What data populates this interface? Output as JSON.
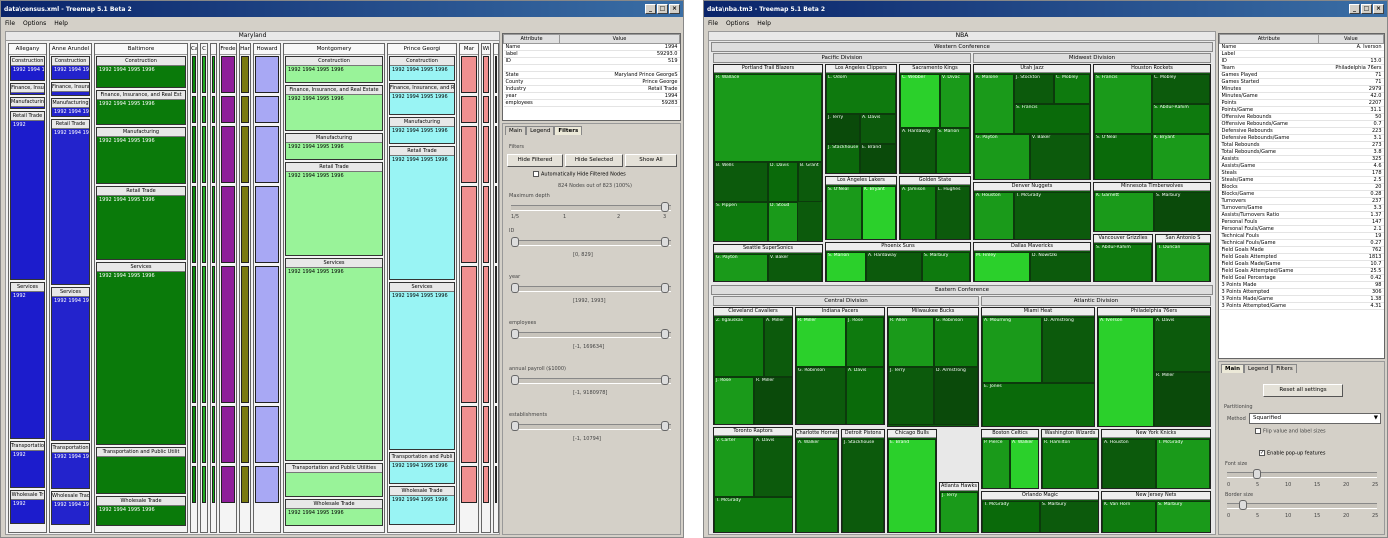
{
  "win1": {
    "title": "data\\census.xml - Treemap 5.1 Beta 2",
    "menu": [
      "File",
      "Options",
      "Help"
    ],
    "root_label": "Maryland",
    "counties": [
      {
        "name": "Allegany",
        "industries": [
          {
            "name": "Construction",
            "yrs": "1992 1994 1995"
          },
          {
            "name": "Finance, Insu",
            "yrs": "1992"
          },
          {
            "name": "Manufacturin",
            "yrs": "1992"
          },
          {
            "name": "Retail Trade",
            "yrs": "1992"
          },
          {
            "name": "Services",
            "yrs": "1992"
          },
          {
            "name": "Transportatio",
            "yrs": "1992"
          },
          {
            "name": "Wholesale Tr",
            "yrs": "1992"
          }
        ]
      },
      {
        "name": "Anne Arundel",
        "industries": [
          {
            "name": "Construction",
            "yrs": "1992 1994 1995"
          },
          {
            "name": "Finance, Insura",
            "yrs": ""
          },
          {
            "name": "Manufacturing",
            "yrs": "1992 1994 1995"
          },
          {
            "name": "Retail Trade",
            "yrs": "1992 1994 1995"
          },
          {
            "name": "Services",
            "yrs": "1992 1994 1995"
          },
          {
            "name": "Transportation",
            "yrs": "1992 1994 1995"
          },
          {
            "name": "Wholesale Trad",
            "yrs": "1992 1994 1995"
          }
        ]
      },
      {
        "name": "Baltimore",
        "industries": [
          {
            "name": "Construction",
            "yrs": "1992 1994 1995 1996"
          },
          {
            "name": "Finance, Insurance, and Real Est",
            "yrs": "1992 1994 1995 1996"
          },
          {
            "name": "Manufacturing",
            "yrs": "1992 1994 1995 1996"
          },
          {
            "name": "Retail Trade",
            "yrs": "1992 1994 1995 1996"
          },
          {
            "name": "Services",
            "yrs": "1992 1994 1995 1996"
          },
          {
            "name": "Transportation and Public Utilit",
            "yrs": ""
          },
          {
            "name": "Wholesale Trade",
            "yrs": "1992 1994 1995 1996"
          }
        ]
      },
      {
        "name": "Montgomery",
        "industries": [
          {
            "name": "Construction",
            "yrs": "1992 1994 1995 1996"
          },
          {
            "name": "Finance, Insurance, and Real Estate",
            "yrs": "1992 1994 1995 1996"
          },
          {
            "name": "Manufacturing",
            "yrs": "1992 1994 1995 1996"
          },
          {
            "name": "Retail Trade",
            "yrs": "1992 1994 1995 1996"
          },
          {
            "name": "Services",
            "yrs": "1992 1994 1995 1996"
          },
          {
            "name": "Transportation and Public Utilities",
            "yrs": ""
          },
          {
            "name": "Wholesale Trade",
            "yrs": "1992 1994 1995 1996"
          }
        ]
      },
      {
        "name": "Prince Georgi",
        "industries": [
          {
            "name": "Construction",
            "yrs": "1992 1994 1995 1996"
          },
          {
            "name": "Finance, Insurance, and R",
            "yrs": "1992 1994 1995 1996"
          },
          {
            "name": "Manufacturing",
            "yrs": "1992 1994 1995 1996"
          },
          {
            "name": "Retail Trade",
            "yrs": "1992 1994 1995 1996"
          },
          {
            "name": "Services",
            "yrs": "1992 1994 1995 1996"
          },
          {
            "name": "Transportation and Publi",
            "yrs": "1992 1994 1995 1996"
          },
          {
            "name": "Wholesale Trade",
            "yrs": "1992 1994 1995 1996"
          }
        ]
      }
    ],
    "small_headers": [
      "Cal",
      "C",
      "Frede",
      "Har",
      "Howard",
      "Mar",
      "Wi"
    ],
    "attr_headers": [
      "Attribute",
      "Value"
    ],
    "attrs": [
      {
        "k": "Name",
        "v": "1994"
      },
      {
        "k": "label",
        "v": "59293.0"
      },
      {
        "k": "ID",
        "v": "519"
      },
      {
        "k": "",
        "v": ""
      },
      {
        "k": "State",
        "v": "Maryland Prince GeorgeS"
      },
      {
        "k": "County",
        "v": "Prince George"
      },
      {
        "k": "Industry",
        "v": "Retail Trade"
      },
      {
        "k": "year",
        "v": "1994"
      },
      {
        "k": "employees",
        "v": "59283"
      }
    ],
    "tabs": [
      "Main",
      "Legend",
      "Filters"
    ],
    "filters_label": "Filters",
    "buttons": {
      "hide_filtered": "Hide Filtered",
      "hide_selected": "Hide Selected",
      "show_all": "Show All"
    },
    "auto_hide": "Automatically Hide Filtered Nodes",
    "counts": "824 Nodes out of 823 (100%)",
    "depth_label": "Maximum depth",
    "depth_ticks": [
      "1/5",
      "1",
      "2",
      "3"
    ],
    "sliders": [
      {
        "name": "ID",
        "range": "[0, 829]"
      },
      {
        "name": "year",
        "range": "[1992, 1993]"
      },
      {
        "name": "employees",
        "range": "[-1, 169634]"
      },
      {
        "name": "annual payroll ($1000)",
        "range": "[-1, 9180978]"
      },
      {
        "name": "establishments",
        "range": "[-1, 10794]"
      }
    ]
  },
  "win2": {
    "title": "data\\nba.tm3 - Treemap 5.1 Beta 2",
    "menu": [
      "File",
      "Options",
      "Help"
    ],
    "root_label": "NBA",
    "west": "Western Conference",
    "east": "Eastern Conference",
    "divisions": {
      "pacific": "Pacific Division",
      "midwest": "Midwest Division",
      "central": "Central Division",
      "atlantic": "Atlantic Division"
    },
    "teams": {
      "portland": "Portland Trail Blazers",
      "clippers": "Los Angeles Clippers",
      "sacramento": "Sacramento Kings",
      "utah": "Utah Jazz",
      "houston": "Houston Rockets",
      "lakers": "Los Angeles Lakers",
      "gsw": "Golden State",
      "seattle": "Seattle SuperSonics",
      "phoenix": "Phoenix Suns",
      "denver": "Denver Nuggets",
      "minnesota": "Minnesota Timberwolves",
      "dallas": "Dallas Mavericks",
      "vancouver": "Vancouver Grizzlies",
      "sanantonio": "San Antonio S",
      "cleveland": "Cleveland Cavaliers",
      "indiana": "Indiana Pacers",
      "milwaukee": "Milwaukee Bucks",
      "miami": "Miami Heat",
      "philadelphia": "Philadelphia 76ers",
      "toronto": "Toronto Raptors",
      "charlotte": "Charlotte Hornets",
      "detroit": "Detroit Pistons",
      "chicago": "Chicago Bulls",
      "atlanta": "Atlanta Hawks",
      "boston": "Boston Celtics",
      "washington": "Washington Wizards",
      "newyork": "New York Knicks",
      "orlando": "Orlando Magic",
      "newjersey": "New Jersey Nets"
    },
    "players": {
      "p1": "R. Wallace",
      "p2": "S. Pippen",
      "p3": "B. Wells",
      "p4": "D. Davis",
      "p5": "B. Grant",
      "p6": "D. Stoud",
      "p7": "L. Odom",
      "p8": "C. Webber",
      "p9": "V. Divac",
      "p10": "K. Malone",
      "p11": "J. Stockton",
      "p12": "S. Francis",
      "p13": "C. Mobley",
      "p14": "G. Payton",
      "p15": "V. Baker",
      "p16": "A. Hardaway",
      "p17": "S. Marion",
      "p18": "S. O'Neal",
      "p19": "K. Bryant",
      "p20": "A. Jamison",
      "p21": "L. Hughes",
      "p22": "M. Finley",
      "p23": "D. Nowitzki",
      "p24": "S. Abdur-Rahim",
      "p25": "T. Duncan",
      "p26": "K. Garnett",
      "p27": "Z. Ilgauskas",
      "p28": "A. Miller",
      "p29": "J. Rose",
      "p30": "R. Miller",
      "p31": "G. Robinson",
      "p32": "R. Allen",
      "p33": "A. Mourning",
      "p34": "A. Iverson",
      "p35": "V. Carter",
      "p36": "A. Davis",
      "p37": "E. Jones",
      "p38": "J. Stackhouse",
      "p39": "E. Brand",
      "p40": "J. Terry",
      "p41": "P. Pierce",
      "p42": "A. Walker",
      "p43": "R. Hamilton",
      "p44": "A. Houston",
      "p45": "T. McGrady",
      "p46": "K. Van Horn",
      "p47": "S. Marbury",
      "p48": "D. Armstrong"
    },
    "attr_headers": [
      "Attribute",
      "Value"
    ],
    "attrs": [
      {
        "k": "Name",
        "v": "A. Iverson"
      },
      {
        "k": "Label",
        "v": ""
      },
      {
        "k": "ID",
        "v": "13.0"
      },
      {
        "k": "Team",
        "v": "Philadelphia 76ers"
      },
      {
        "k": "Games Played",
        "v": "71"
      },
      {
        "k": "Games Started",
        "v": "71"
      },
      {
        "k": "Minutes",
        "v": "2979"
      },
      {
        "k": "Minutes/Game",
        "v": "42.0"
      },
      {
        "k": "Points",
        "v": "2207"
      },
      {
        "k": "Points/Game",
        "v": "31.1"
      },
      {
        "k": "Offensive Rebounds",
        "v": "50"
      },
      {
        "k": "Offensive Rebounds/Game",
        "v": "0.7"
      },
      {
        "k": "Defensive Rebounds",
        "v": "223"
      },
      {
        "k": "Defensive Rebounds/Game",
        "v": "3.1"
      },
      {
        "k": "Total Rebounds",
        "v": "273"
      },
      {
        "k": "Total Rebounds/Game",
        "v": "3.8"
      },
      {
        "k": "Assists",
        "v": "325"
      },
      {
        "k": "Assists/Game",
        "v": "4.6"
      },
      {
        "k": "Steals",
        "v": "178"
      },
      {
        "k": "Steals/Game",
        "v": "2.5"
      },
      {
        "k": "Blocks",
        "v": "20"
      },
      {
        "k": "Blocks/Game",
        "v": "0.28"
      },
      {
        "k": "Turnovers",
        "v": "237"
      },
      {
        "k": "Turnovers/Game",
        "v": "3.3"
      },
      {
        "k": "Assists/Turnovers Ratio",
        "v": "1.37"
      },
      {
        "k": "Personal Fouls",
        "v": "147"
      },
      {
        "k": "Personal Fouls/Game",
        "v": "2.1"
      },
      {
        "k": "Technical Fouls",
        "v": "19"
      },
      {
        "k": "Technical Fouls/Game",
        "v": "0.27"
      },
      {
        "k": "Field Goals Made",
        "v": "762"
      },
      {
        "k": "Field Goals Attempted",
        "v": "1813"
      },
      {
        "k": "Field Goals Made/Game",
        "v": "10.7"
      },
      {
        "k": "Field Goals Attempted/Game",
        "v": "25.5"
      },
      {
        "k": "Field Goal Percentage",
        "v": "0.42"
      },
      {
        "k": "3 Points Made",
        "v": "98"
      },
      {
        "k": "3 Points Attempted",
        "v": "306"
      },
      {
        "k": "3 Points Made/Game",
        "v": "1.38"
      },
      {
        "k": "3 Points Attempted/Game",
        "v": "4.31"
      }
    ],
    "tabs": [
      "Main",
      "Legend",
      "Filters"
    ],
    "reset": "Reset all settings",
    "partitioning": "Partitioning",
    "method_label": "Method",
    "method_value": "Squarified",
    "flip_label": "Flip value and label sizes",
    "popup_label": "Enable pop-up features",
    "font_size_label": "Font size",
    "border_size_label": "Border size",
    "ticks": [
      "0",
      "5",
      "10",
      "15",
      "20",
      "25"
    ]
  },
  "colors": {
    "dark_blue": "#1c1ccc",
    "blue": "#3b3bd6",
    "green_dark": "#0a7a0a",
    "green": "#11a011",
    "light_green": "#99f399",
    "cyan": "#99f4f4",
    "purple": "#8e1e9a",
    "olive": "#7a7a10",
    "lavender": "#a8a8f4",
    "pink": "#f09090",
    "nba_dark": "#0c5a0c",
    "nba_mid": "#1a9a1a",
    "nba_bright": "#2bd02b"
  }
}
